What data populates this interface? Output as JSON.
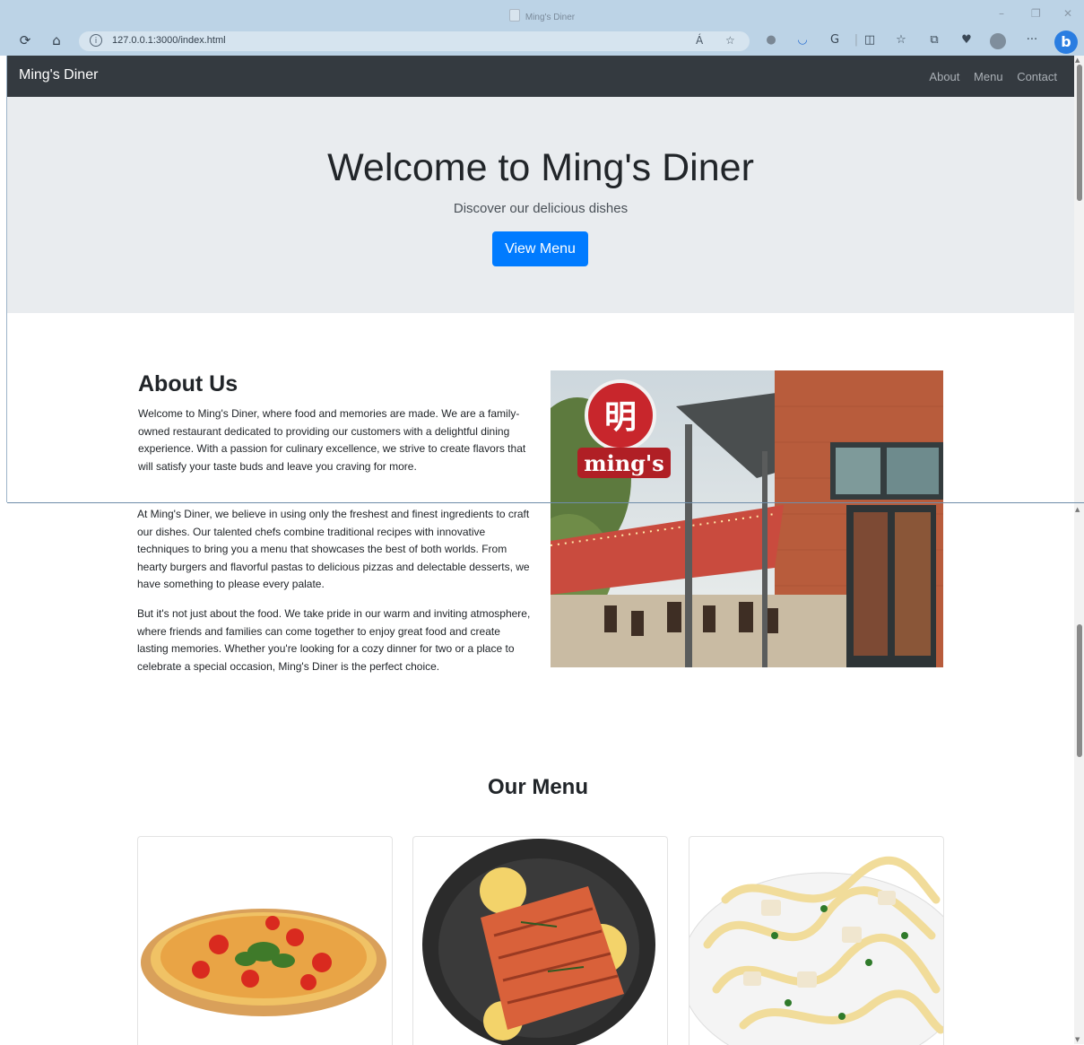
{
  "browser": {
    "tab_title": "Ming's Diner",
    "url": "127.0.0.1:3000/index.html",
    "read_aloud": "Á",
    "more": "···",
    "bing": "b",
    "window_controls": [
      "–",
      "❐",
      "✕"
    ]
  },
  "navbar": {
    "brand": "Ming's Diner",
    "links": [
      "About",
      "Menu",
      "Contact"
    ]
  },
  "hero": {
    "title": "Welcome to Ming's Diner",
    "subtitle": "Discover our delicious dishes",
    "button": "View Menu",
    "button_color": "#007bff"
  },
  "about": {
    "heading": "About Us",
    "p1": "Welcome to Ming's Diner, where food and memories are made. We are a family-owned restaurant dedicated to providing our customers with a delightful dining experience. With a passion for culinary excellence, we strive to create flavors that will satisfy your taste buds and leave you craving for more.",
    "p2": "At Ming's Diner, we believe in using only the freshest and finest ingredients to craft our dishes. Our talented chefs combine traditional recipes with innovative techniques to bring you a menu that showcases the best of both worlds. From hearty burgers and flavorful pastas to delicious pizzas and delectable desserts, we have something to please every palate.",
    "p3": "But it's not just about the food. We take pride in our warm and inviting atmosphere, where friends and families can come together to enjoy great food and create lasting memories. Whether you're looking for a cozy dinner for two or a place to celebrate a special occasion, Ming's Diner is the perfect choice.",
    "sign_text": "ming's",
    "sign_glyph": "明"
  },
  "menu": {
    "heading": "Our Menu"
  }
}
